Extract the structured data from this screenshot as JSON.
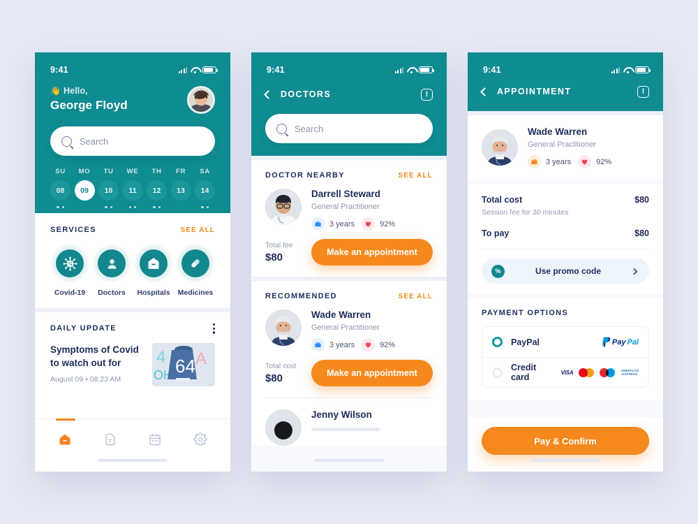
{
  "status_bar": {
    "time": "9:41",
    "icons": [
      "signal-icon",
      "wifi-icon",
      "battery-icon"
    ]
  },
  "colors": {
    "teal": "#0f8b92",
    "orange": "#f5891d",
    "navy": "#1c2b5a",
    "page_bg": "#e6e9f4",
    "panel_bg": "#f7f9fd"
  },
  "phone1": {
    "greeting": "Hello,",
    "wave_emoji": "👋",
    "user_name": "George Floyd",
    "avatar": "user-avatar",
    "search": {
      "placeholder": "Search",
      "icon": "search-icon"
    },
    "week": [
      {
        "dow": "SU",
        "date": "08",
        "active": false,
        "dots": 2
      },
      {
        "dow": "MO",
        "date": "09",
        "active": true,
        "dots": 0
      },
      {
        "dow": "TU",
        "date": "10",
        "active": false,
        "dots": 2
      },
      {
        "dow": "WE",
        "date": "11",
        "active": false,
        "dots": 2
      },
      {
        "dow": "TH",
        "date": "12",
        "active": false,
        "dots": 2
      },
      {
        "dow": "FR",
        "date": "13",
        "active": false,
        "dots": 0
      },
      {
        "dow": "SA",
        "date": "14",
        "active": false,
        "dots": 2
      }
    ],
    "services": {
      "title": "SERVICES",
      "see_all": "SEE ALL",
      "items": [
        {
          "label": "Covid-19",
          "icon": "virus-icon"
        },
        {
          "label": "Doctors",
          "icon": "person-icon"
        },
        {
          "label": "Hospitals",
          "icon": "hospital-icon"
        },
        {
          "label": "Medicines",
          "icon": "pill-icon"
        }
      ]
    },
    "daily_update": {
      "title": "DAILY UPDATE",
      "menu_icon": "kebab-menu-icon",
      "headline": "Symptoms of Covid to watch out for",
      "meta": "August 09 • 08.23 AM",
      "thumbnail": "news-thumbnail"
    },
    "tabbar": {
      "items": [
        {
          "icon": "home-icon",
          "active": true
        },
        {
          "icon": "document-icon",
          "active": false
        },
        {
          "icon": "calendar-icon",
          "active": false
        },
        {
          "icon": "gear-icon",
          "active": false
        }
      ]
    }
  },
  "phone2": {
    "nav": {
      "back_icon": "chevron-left-icon",
      "title": "DOCTORS",
      "info_icon": "info-icon"
    },
    "search": {
      "placeholder": "Search",
      "icon": "search-icon"
    },
    "sections": [
      {
        "title": "DOCTOR NEARBY",
        "see_all": "SEE ALL",
        "doctor": {
          "name": "Darrell Steward",
          "role": "General Practitioner",
          "experience": "3 years",
          "rating": "92%",
          "experience_icon": "briefcase-icon",
          "rating_icon": "heart-icon",
          "fee_label": "Total fee",
          "fee_value": "$80",
          "cta": "Make an appointment"
        }
      },
      {
        "title": "RECOMMENDED",
        "see_all": "SEE ALL",
        "doctor": {
          "name": "Wade Warren",
          "role": "General Practitioner",
          "experience": "3 years",
          "rating": "92%",
          "experience_icon": "briefcase-icon",
          "rating_icon": "heart-icon",
          "fee_label": "Total cost",
          "fee_value": "$80",
          "cta": "Make an appointment"
        }
      }
    ],
    "next_doctor": {
      "name": "Jenny Wilson"
    }
  },
  "phone3": {
    "nav": {
      "back_icon": "chevron-left-icon",
      "title": "APPOINTMENT",
      "info_icon": "info-icon"
    },
    "doctor": {
      "name": "Wade Warren",
      "role": "General Practitioner",
      "experience": "3 years",
      "rating": "92%",
      "experience_icon": "briefcase-icon",
      "rating_icon": "heart-icon"
    },
    "cost": {
      "total_label": "Total cost",
      "total_value": "$80",
      "subtitle": "Session fee for 30 minutes",
      "topay_label": "To pay",
      "topay_value": "$80",
      "promo_label": "Use promo code",
      "promo_icon": "discount-badge-icon",
      "promo_chevron": "chevron-right-icon"
    },
    "payment": {
      "title": "PAYMENT OPTIONS",
      "options": [
        {
          "label": "PayPal",
          "selected": true,
          "brand": "paypal-logo"
        },
        {
          "label": "Credit card",
          "selected": false,
          "brands": [
            "visa-logo",
            "mastercard-logo",
            "maestro-logo",
            "amex-logo"
          ]
        }
      ],
      "paypal_word_a": "Pay",
      "paypal_word_b": "Pal",
      "visa_text": "VISA",
      "amex_line1": "AMERICAN",
      "amex_line2": "EXPRESS"
    },
    "confirm_button": "Pay & Confirm"
  }
}
